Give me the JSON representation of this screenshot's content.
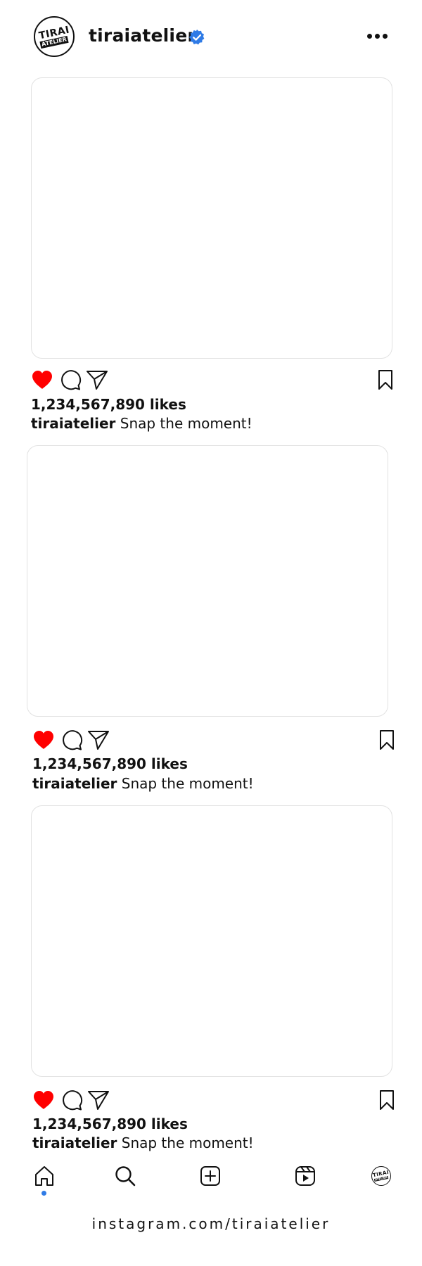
{
  "header": {
    "username": "tiraiatelier",
    "avatar_logo_line1": "TIRAI",
    "avatar_logo_line2": "ATELIER",
    "verified_icon": "verified-badge-icon",
    "more_icon": "more-options-icon"
  },
  "colors": {
    "like_red": "#ff0000",
    "verified_blue": "#2f7be6",
    "text": "#111111"
  },
  "posts": [
    {
      "likes": "1,234,567,890 likes",
      "caption_user": "tiraiatelier",
      "caption_text": "Snap the moment!",
      "liked": true
    },
    {
      "likes": "1,234,567,890 likes",
      "caption_user": "tiraiatelier",
      "caption_text": "Snap the moment!",
      "liked": true
    },
    {
      "likes": "1,234,567,890 likes",
      "caption_user": "tiraiatelier",
      "caption_text": "Snap the moment!",
      "liked": true
    }
  ],
  "bottom_nav": {
    "items": [
      "home-icon",
      "search-icon",
      "create-post-icon",
      "reels-icon",
      "profile-avatar"
    ],
    "active": "home-icon"
  },
  "footer": {
    "url": "instagram.com/tiraiatelier"
  }
}
